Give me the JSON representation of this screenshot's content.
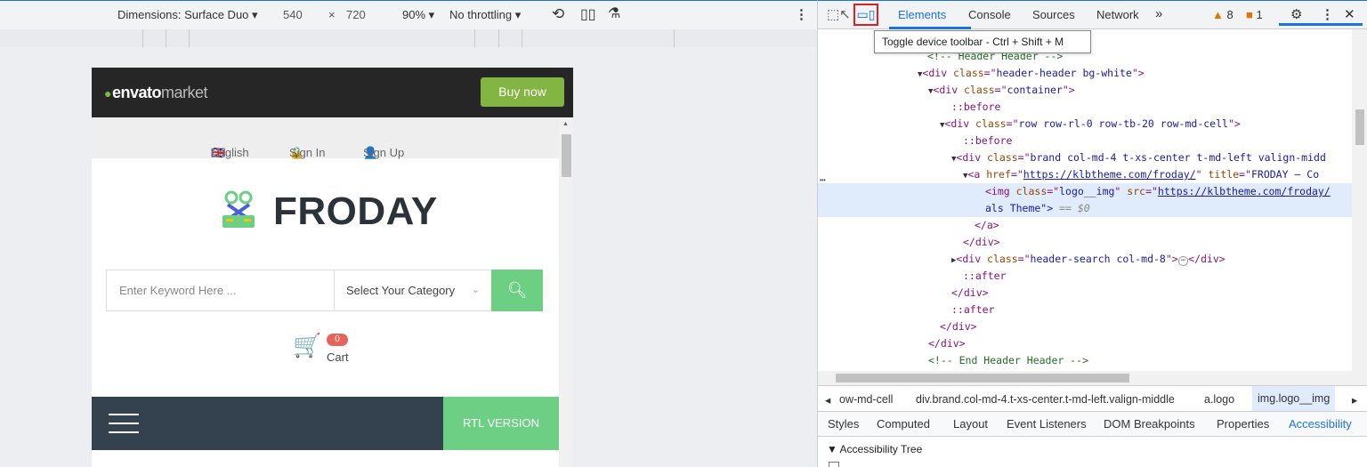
{
  "device_toolbar": {
    "dimensions": "Dimensions: Surface Duo ▾",
    "width": "540",
    "times": "×",
    "height": "720",
    "zoom": "90% ▾",
    "throttle": "No throttling ▾",
    "more": "⋮"
  },
  "site": {
    "envato_prefix": "envato",
    "envato_suffix": "market",
    "buy_now": "Buy now",
    "lang_english": "English",
    "sign_in": "Sign In",
    "sign_up": "Sign Up",
    "logo_text": "FRODAY",
    "search_placeholder": "Enter Keyword Here ...",
    "category_placeholder": "Select Your Category",
    "cart_count": "0",
    "cart_label": "Cart",
    "rtl_label": "RTL VERSION"
  },
  "devtools": {
    "tabs": [
      "Elements",
      "Console",
      "Sources",
      "Network",
      "»"
    ],
    "warnings": "8",
    "issues": "1",
    "tooltip": "Toggle device toolbar - Ctrl + Shift + M",
    "breadcrumbs": [
      "ow-md-cell",
      "div.brand.col-md-4.t-xs-center.t-md-left.valign-middle",
      "a.logo",
      "img.logo__img"
    ],
    "subtabs": [
      "Styles",
      "Computed",
      "Layout",
      "Event Listeners",
      "DOM Breakpoints",
      "Properties",
      "Accessibility"
    ],
    "accessibility_tree": "▼ Accessibility Tree"
  },
  "dom": {
    "l0": "<!-- Header Header -->",
    "l1_tag": "header-header bg-white",
    "l2_tag": "container",
    "before": "::before",
    "after": "::after",
    "l4_tag": "row row-rl-0 row-tb-20 row-md-cell",
    "l6_tag": "brand col-md-4 t-xs-center t-md-left valign-midd",
    "a_href": "https://klbtheme.com/froday/",
    "a_title": "FRODAY – Co",
    "img_class": "logo__img",
    "img_src": "https://klbtheme.com/froday/",
    "img_cont": "als Theme\">",
    "eq": "== $0",
    "close_a": "</a>",
    "close_div": "</div>",
    "search_class": "header-search col-md-8",
    "end_comment": "<!-- End Header Header -->"
  },
  "colors": {
    "accent": "#1a73e8",
    "site_green": "#6ccf83",
    "envato_green": "#82b541",
    "nav_dark": "#34414f",
    "highlight_red": "#e02020"
  }
}
